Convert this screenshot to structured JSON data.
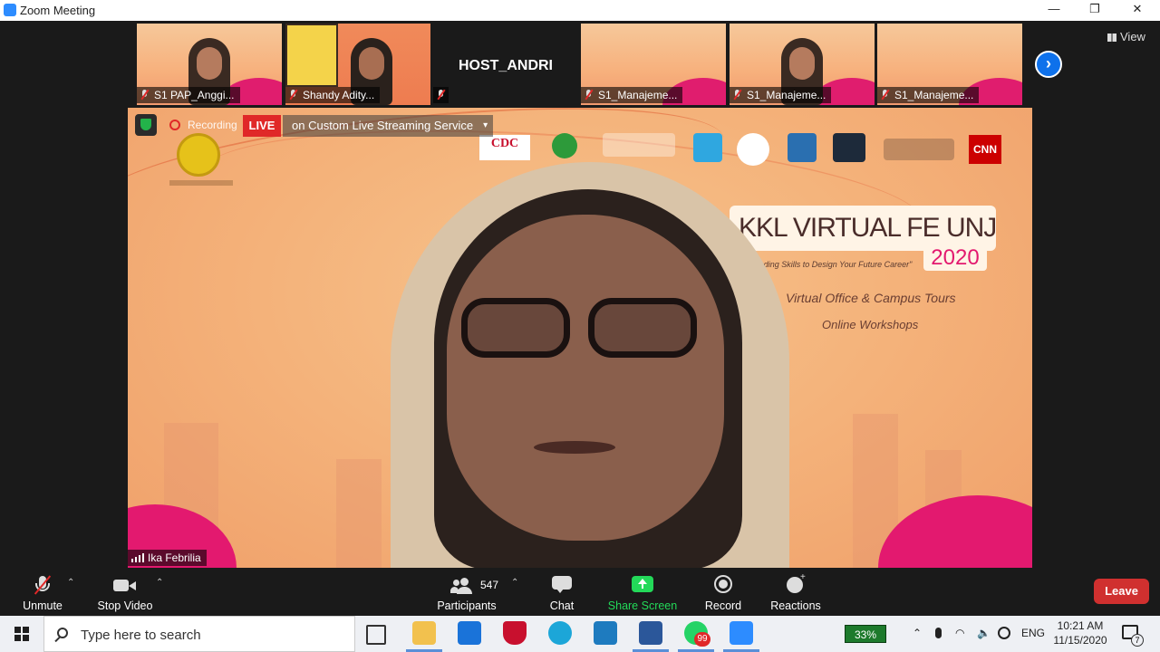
{
  "window": {
    "title": "Zoom Meeting",
    "minimize": "—",
    "restore": "❐",
    "close": "✕"
  },
  "gallery": {
    "view_label": "View",
    "tiles": [
      {
        "name": "S1 PAP_Anggi..."
      },
      {
        "name": "Shandy Adity..."
      },
      {
        "name": ""
      },
      {
        "name": "S1_Manajeme..."
      },
      {
        "name": "S1_Manajeme..."
      },
      {
        "name": "S1_Manajeme..."
      }
    ],
    "host_name": "HOST_ANDRI",
    "next_icon": "›"
  },
  "main_video": {
    "recording_label": "Recording",
    "live_badge": "LIVE",
    "live_service": "on Custom Live Streaming Service",
    "live_caret": "▾",
    "speaker_name": "Ika Febrilia",
    "slide": {
      "title": "KKL VIRTUAL FE UNJ",
      "year": "2020",
      "tagline": "\"Upgrading Skills to Design Your Future Career\"",
      "line1": "Virtual Office & Campus Tours",
      "line2": "Online Workshops",
      "cdc": "CDC",
      "cnn": "CNN"
    }
  },
  "toolbar": {
    "unmute": "Unmute",
    "stop_video": "Stop Video",
    "participants": "Participants",
    "participants_count": "547",
    "chat": "Chat",
    "share_screen": "Share Screen",
    "record": "Record",
    "reactions": "Reactions",
    "leave": "Leave",
    "caret": "⌃"
  },
  "taskbar": {
    "search_placeholder": "Type here to search",
    "whatsapp_badge": "99",
    "battery": "33%",
    "lang": "ENG",
    "time": "10:21 AM",
    "date": "11/15/2020",
    "notifications": "7"
  },
  "colors": {
    "accent_blue": "#0e71eb",
    "share_green": "#23d959",
    "leave_red": "#d0302f",
    "live_red": "#e02828"
  }
}
